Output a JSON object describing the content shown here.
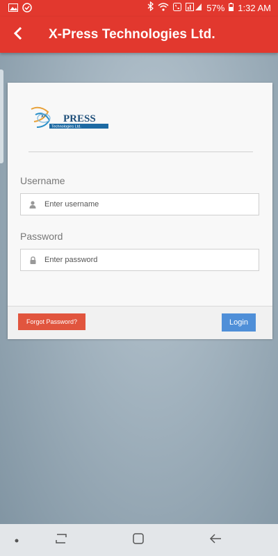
{
  "status_bar": {
    "battery": "57%",
    "time": "1:32 AM",
    "icons": [
      "image-icon",
      "check-circle-icon",
      "bluetooth-icon",
      "wifi-icon",
      "call-icon",
      "signal-icon",
      "battery-icon"
    ]
  },
  "toolbar": {
    "title": "X-Press Technologies Ltd.",
    "back_icon": "chevron-left-icon",
    "color": "#e2382e"
  },
  "logo": {
    "brand": "PRESS",
    "prefix": "X-",
    "tagline": "Technologies Ltd."
  },
  "form": {
    "username": {
      "label": "Username",
      "placeholder": "Enter username",
      "value": "",
      "icon": "user-icon"
    },
    "password": {
      "label": "Password",
      "placeholder": "Enter password",
      "value": "",
      "icon": "lock-icon"
    },
    "forgot_label": "Forgot Password?",
    "login_label": "Login"
  },
  "nav": {
    "items": [
      "dot-icon",
      "recents-icon",
      "home-icon",
      "back-arrow-icon"
    ]
  }
}
